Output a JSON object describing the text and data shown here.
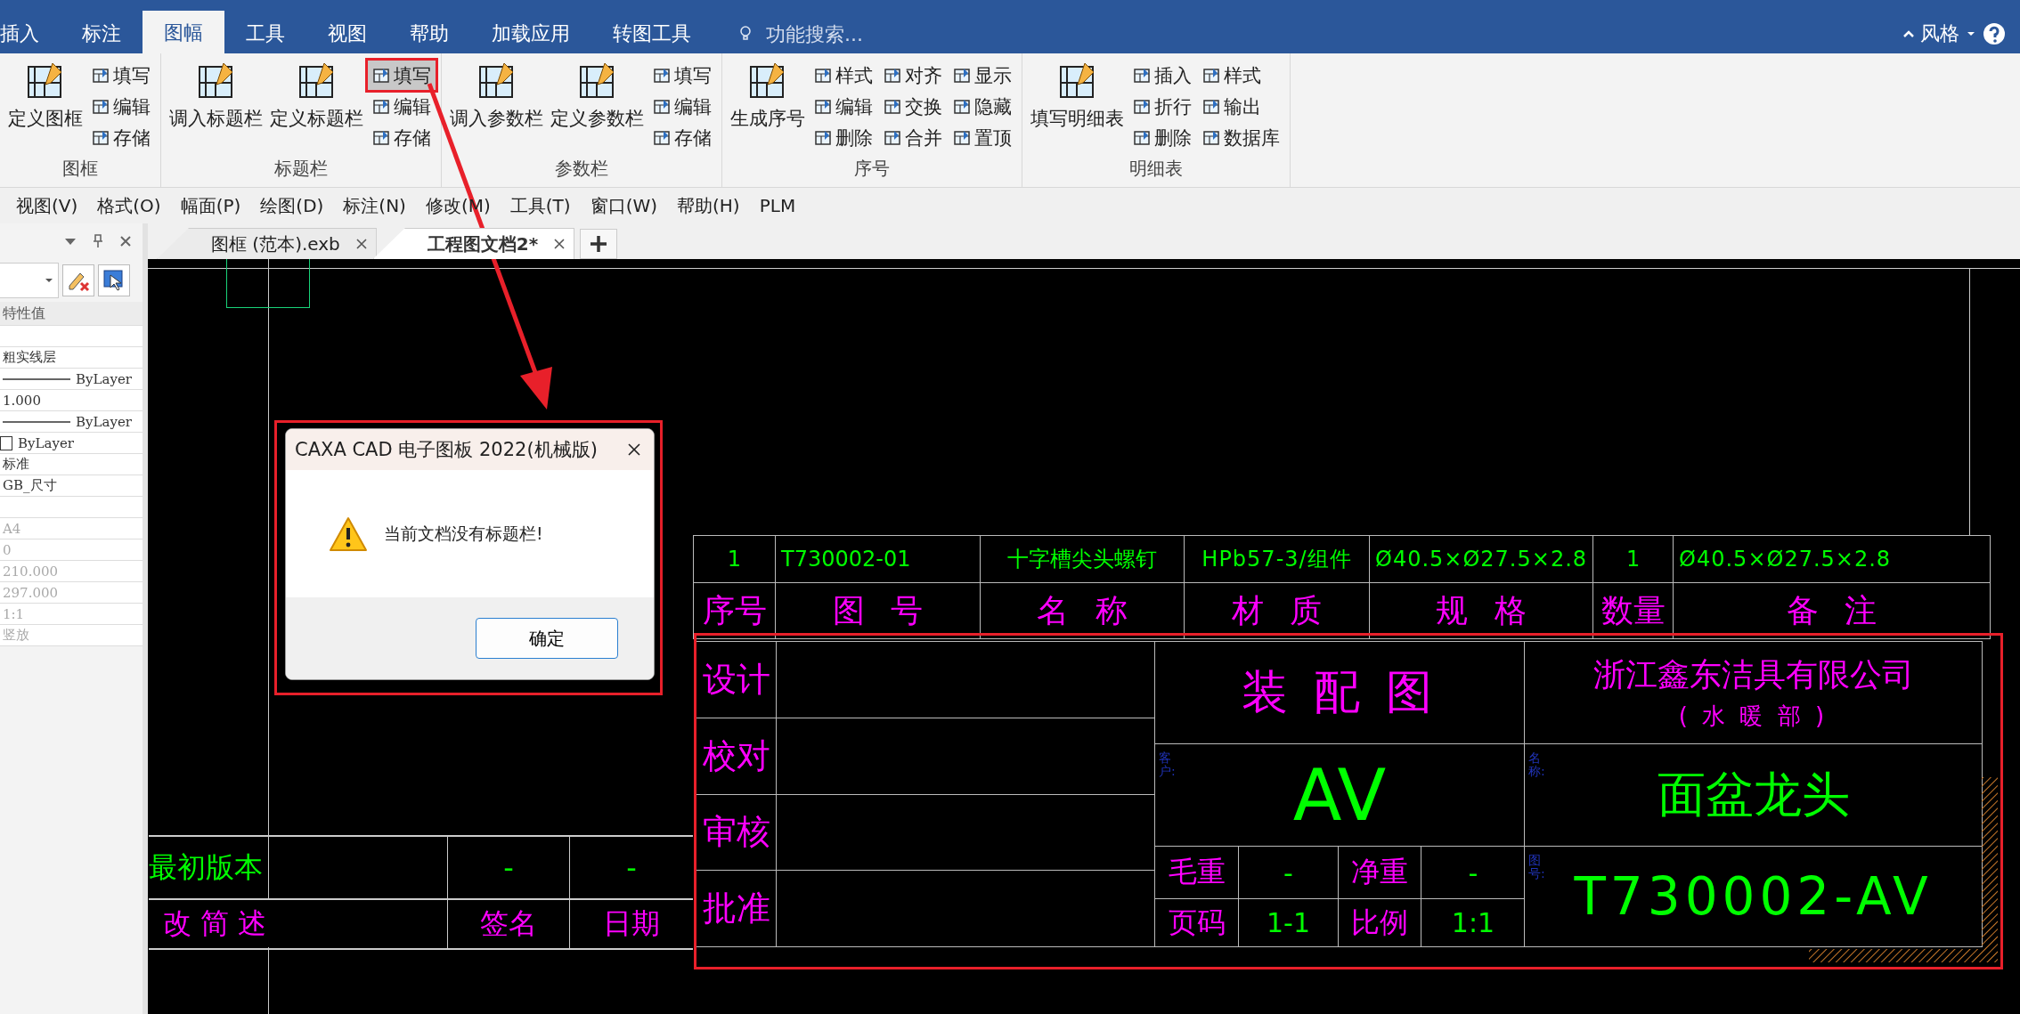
{
  "ribbon_tabs": [
    {
      "label": "插入",
      "selected": false
    },
    {
      "label": "标注",
      "selected": false
    },
    {
      "label": "图幅",
      "selected": true
    },
    {
      "label": "工具",
      "selected": false
    },
    {
      "label": "视图",
      "selected": false
    },
    {
      "label": "帮助",
      "selected": false
    },
    {
      "label": "加载应用",
      "selected": false
    },
    {
      "label": "转图工具",
      "selected": false
    }
  ],
  "search": {
    "placeholder": "功能搜索..."
  },
  "style_menu": {
    "label": "风格"
  },
  "ribbon_groups": [
    {
      "label": "图框",
      "items": [
        {
          "kind": "large",
          "label": "定义图框",
          "selected": false
        },
        {
          "kind": "column",
          "items": [
            {
              "label": "填写",
              "selected": false
            },
            {
              "label": "编辑",
              "selected": false
            },
            {
              "label": "存储",
              "selected": false
            }
          ]
        }
      ]
    },
    {
      "label": "标题栏",
      "items": [
        {
          "kind": "large",
          "label": "调入标题栏",
          "selected": false
        },
        {
          "kind": "large",
          "label": "定义标题栏",
          "selected": false
        },
        {
          "kind": "column",
          "items": [
            {
              "label": "填写",
              "selected": true
            },
            {
              "label": "编辑",
              "selected": false
            },
            {
              "label": "存储",
              "selected": false
            }
          ]
        }
      ]
    },
    {
      "label": "参数栏",
      "items": [
        {
          "kind": "large",
          "label": "调入参数栏",
          "selected": false
        },
        {
          "kind": "large",
          "label": "定义参数栏",
          "selected": false
        },
        {
          "kind": "column",
          "items": [
            {
              "label": "填写",
              "selected": false
            },
            {
              "label": "编辑",
              "selected": false
            },
            {
              "label": "存储",
              "selected": false
            }
          ]
        }
      ]
    },
    {
      "label": "序号",
      "items": [
        {
          "kind": "large",
          "label": "生成序号",
          "selected": false
        },
        {
          "kind": "column",
          "items": [
            {
              "label": "样式",
              "selected": false
            },
            {
              "label": "编辑",
              "selected": false
            },
            {
              "label": "删除",
              "selected": false
            }
          ]
        },
        {
          "kind": "column",
          "items": [
            {
              "label": "对齐",
              "selected": false
            },
            {
              "label": "交换",
              "selected": false
            },
            {
              "label": "合并",
              "selected": false
            }
          ]
        },
        {
          "kind": "column",
          "items": [
            {
              "label": "显示",
              "selected": false
            },
            {
              "label": "隐藏",
              "selected": false
            },
            {
              "label": "置顶",
              "selected": false
            }
          ]
        }
      ]
    },
    {
      "label": "明细表",
      "items": [
        {
          "kind": "large",
          "label": "填写明细表",
          "selected": false
        },
        {
          "kind": "column",
          "items": [
            {
              "label": "插入",
              "selected": false
            },
            {
              "label": "折行",
              "selected": false
            },
            {
              "label": "删除",
              "selected": false
            }
          ]
        },
        {
          "kind": "column",
          "items": [
            {
              "label": "样式",
              "selected": false
            },
            {
              "label": "输出",
              "selected": false
            },
            {
              "label": "数据库",
              "selected": false
            }
          ]
        }
      ]
    }
  ],
  "menu_bar": [
    "视图(V)",
    "格式(O)",
    "幅面(P)",
    "绘图(D)",
    "标注(N)",
    "修改(M)",
    "工具(T)",
    "窗口(W)",
    "帮助(H)",
    "PLM"
  ],
  "properties": {
    "header": "特性值",
    "rows": [
      {
        "kind": "blank"
      },
      {
        "kind": "text",
        "value": "粗实线层",
        "disabled": false
      },
      {
        "kind": "line",
        "value": "ByLayer",
        "disabled": false
      },
      {
        "kind": "text",
        "value": "1.000",
        "disabled": false
      },
      {
        "kind": "line",
        "value": "ByLayer",
        "disabled": false
      },
      {
        "kind": "swatch",
        "value": "ByLayer",
        "disabled": false
      },
      {
        "kind": "text",
        "value": "标准",
        "disabled": false
      },
      {
        "kind": "text",
        "value": "GB_尺寸",
        "disabled": false
      },
      {
        "kind": "blank"
      },
      {
        "kind": "text",
        "value": "A4",
        "disabled": true
      },
      {
        "kind": "text",
        "value": "0",
        "disabled": true
      },
      {
        "kind": "text",
        "value": "210.000",
        "disabled": true
      },
      {
        "kind": "text",
        "value": "297.000",
        "disabled": true
      },
      {
        "kind": "text",
        "value": "1:1",
        "disabled": true
      },
      {
        "kind": "text",
        "value": "竖放",
        "disabled": true
      }
    ]
  },
  "doc_tabs": [
    {
      "label": "图框 (范本).exb",
      "selected": false
    },
    {
      "label": "工程图文档2*",
      "selected": true
    }
  ],
  "bom": {
    "rows": [
      [
        "1",
        "T730002-01",
        "十字槽尖头螺钉",
        "HPb57-3/组件",
        "Ø40.5×Ø27.5×2.8",
        "1",
        "Ø40.5×Ø27.5×2.8"
      ]
    ],
    "header": [
      "序号",
      "图 号",
      "名 称",
      "材 质",
      "规 格",
      "数量",
      "备 注"
    ]
  },
  "title_block": {
    "signoff": [
      "设计",
      "校对",
      "审核",
      "批准"
    ],
    "drawing_type": "装 配 图",
    "company": "浙江鑫东洁具有限公司",
    "department": "( 水 暖 部 )",
    "customer_label": "客户:",
    "customer": "AV",
    "name_label": "名称:",
    "name": "面盆龙头",
    "number_label": "图号:",
    "number": "T730002-AV",
    "weights": [
      {
        "label": "毛重",
        "value": "-"
      },
      {
        "label": "净重",
        "value": "-"
      },
      {
        "label": "页码",
        "value": "1-1"
      },
      {
        "label": "比例",
        "value": "1:1"
      }
    ]
  },
  "revision": {
    "row": [
      "最初版本",
      "-",
      "-"
    ],
    "header": [
      "改 简 述",
      "签名",
      "日期"
    ]
  },
  "dialog": {
    "title": "CAXA CAD 电子图板 2022(机械版)",
    "message": "当前文档没有标题栏!",
    "ok": "确定"
  }
}
